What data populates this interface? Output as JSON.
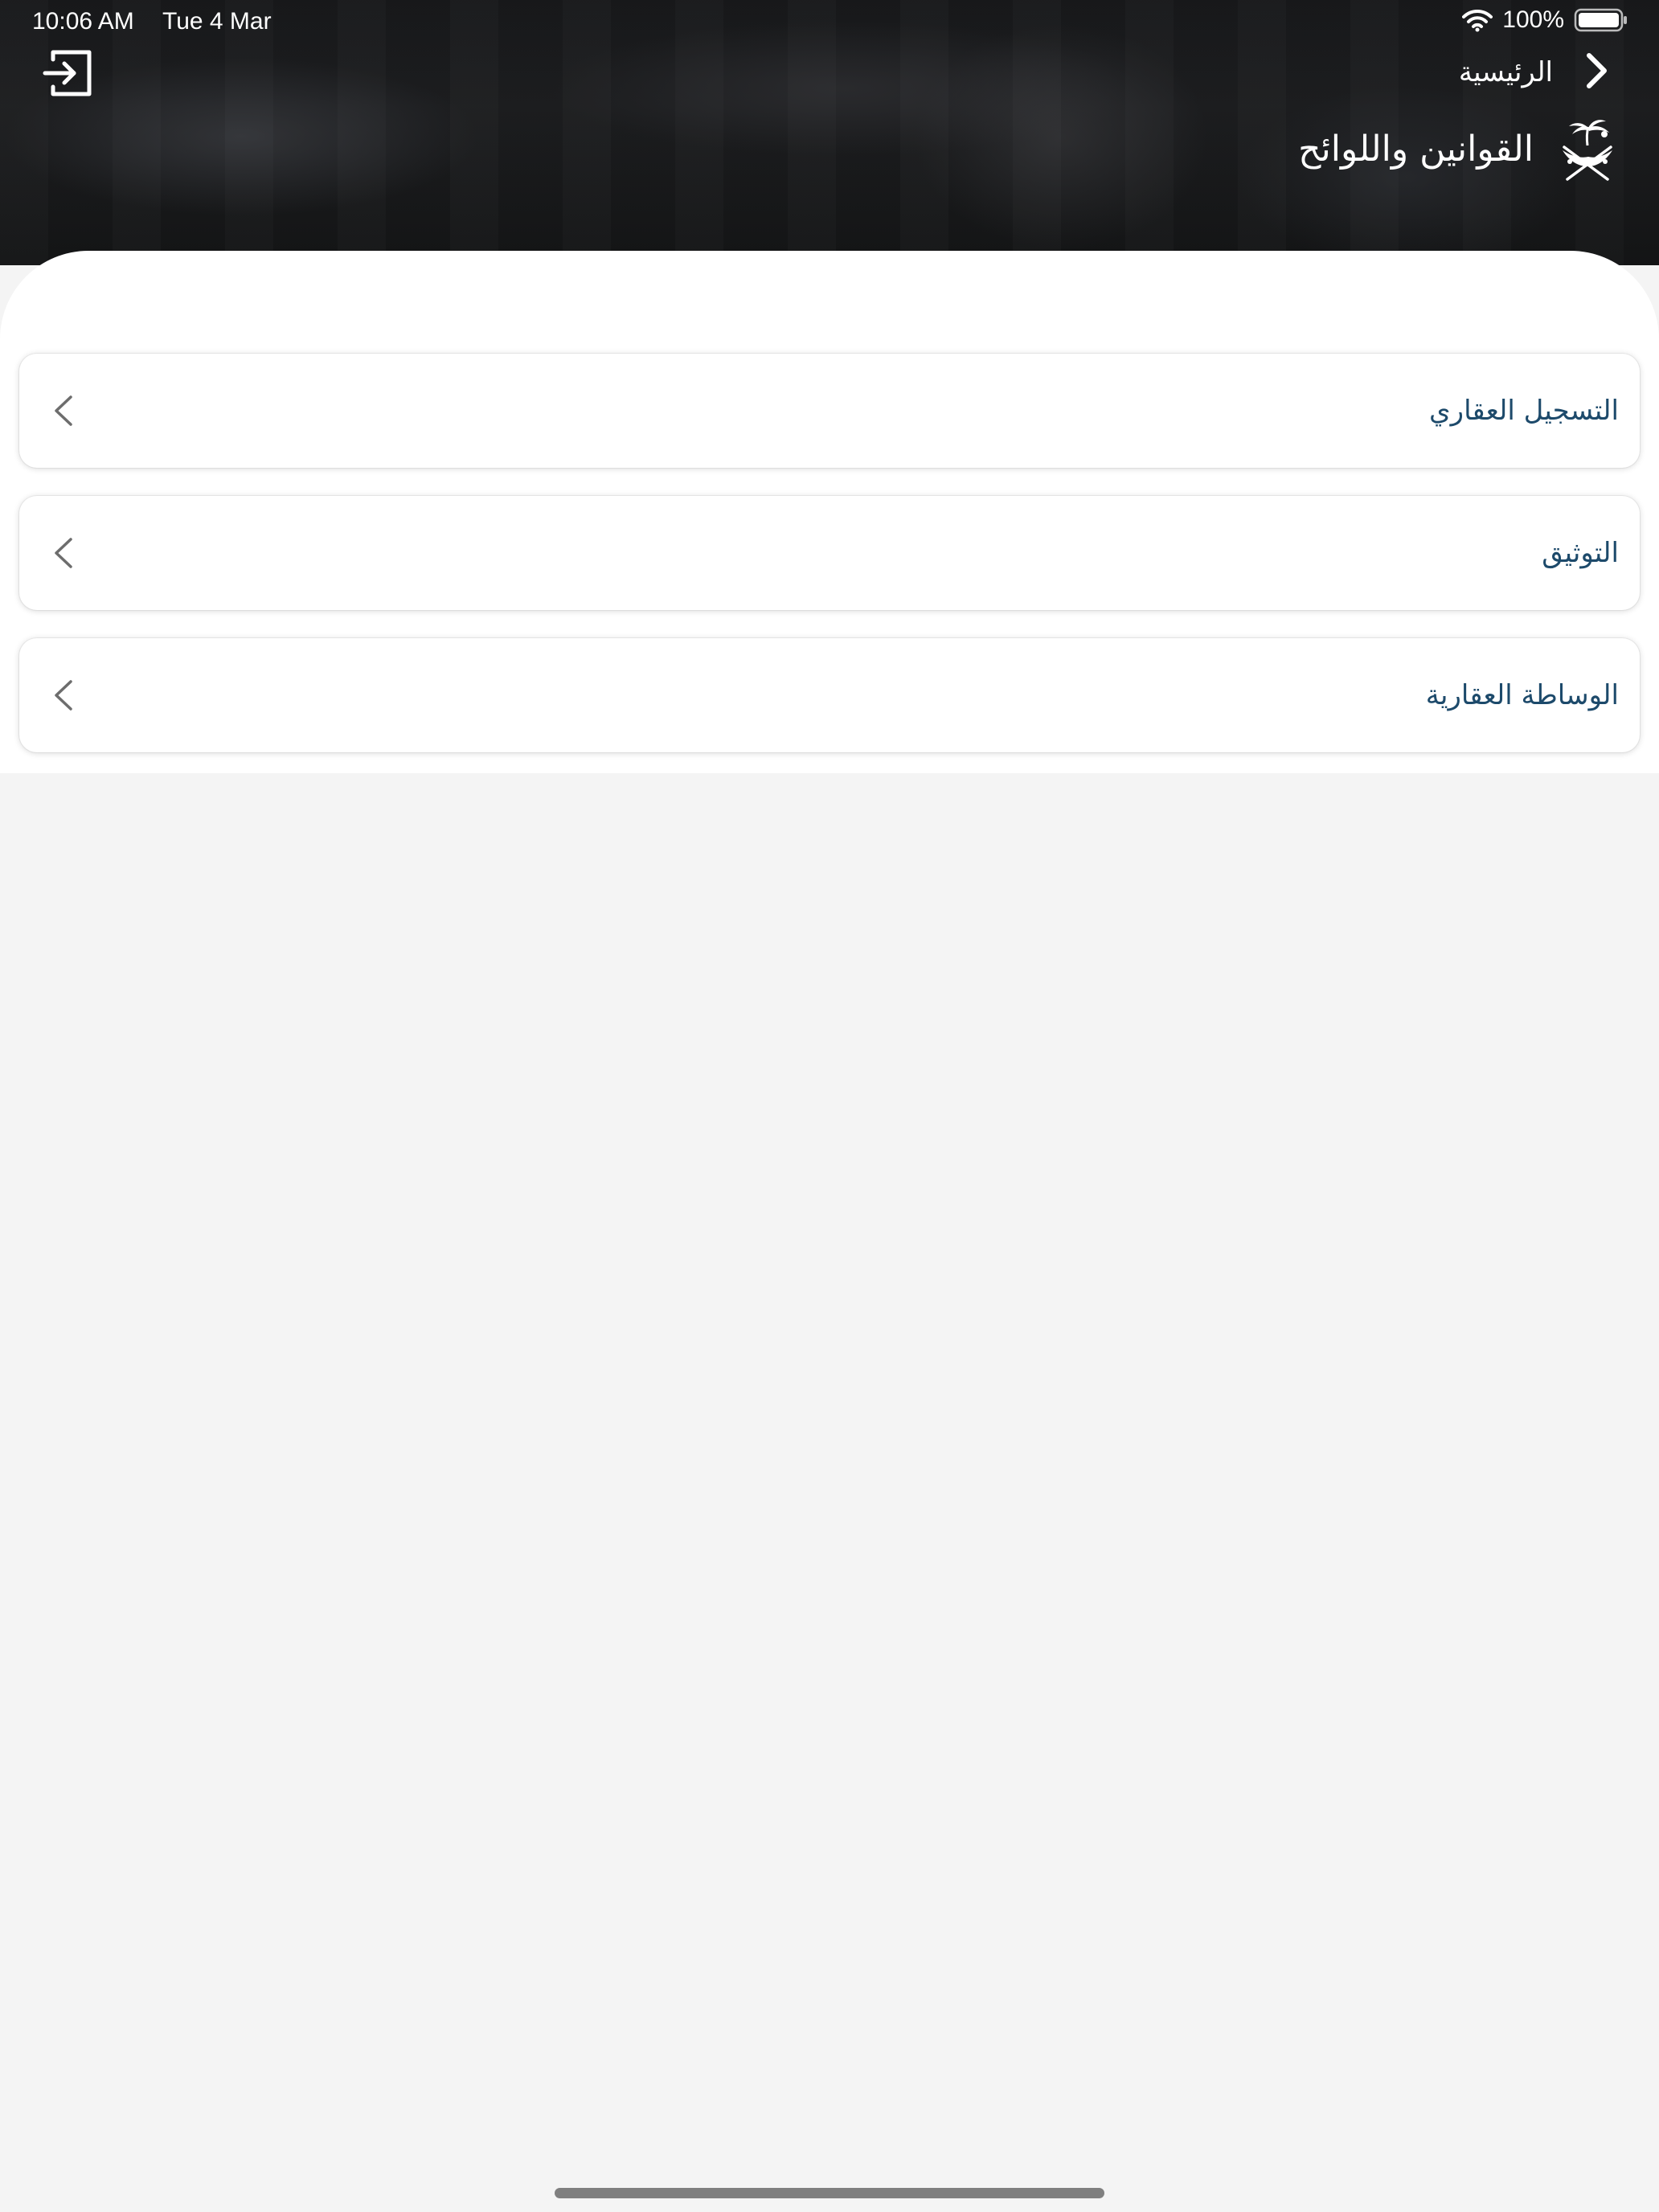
{
  "status_bar": {
    "time": "10:06 AM",
    "date": "Tue 4 Mar",
    "battery": "100%",
    "icons": [
      "wifi-icon",
      "battery-icon"
    ]
  },
  "header": {
    "back_label": "الرئيسية",
    "title": "القوانين واللوائح",
    "icons": [
      "logout-icon",
      "chevron-right-icon",
      "emblem-icon"
    ]
  },
  "list": {
    "items": [
      {
        "label": "التسجيل العقاري"
      },
      {
        "label": "التوثيق"
      },
      {
        "label": "الوساطة العقارية"
      }
    ],
    "item_icon": "chevron-left-icon"
  },
  "colors": {
    "header_bg": "#18191b",
    "item_text": "#1d4a6b",
    "page_bg": "#f4f4f4",
    "sheet_bg": "#ffffff"
  }
}
